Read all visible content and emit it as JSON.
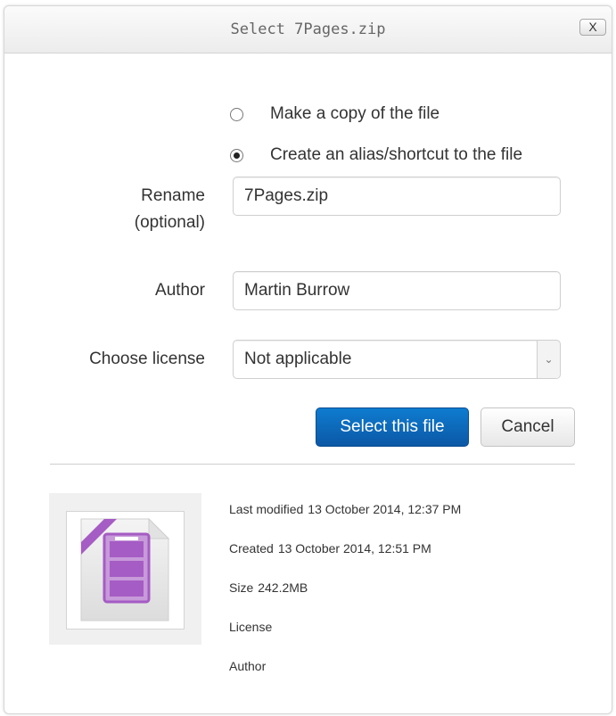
{
  "dialog": {
    "title": "Select 7Pages.zip",
    "close_label": "X"
  },
  "options": [
    {
      "label": "Make a copy of the file",
      "checked": false
    },
    {
      "label": "Create an alias/shortcut to the file",
      "checked": true
    }
  ],
  "form": {
    "rename_label_line1": "Rename",
    "rename_label_line2": "(optional)",
    "rename_value": "7Pages.zip",
    "author_label": "Author",
    "author_value": "Martin Burrow",
    "license_label": "Choose license",
    "license_value": "Not applicable"
  },
  "buttons": {
    "select": "Select this file",
    "cancel": "Cancel"
  },
  "file_info": {
    "last_modified_label": "Last modified",
    "last_modified_value": "13 October 2014, 12:37 PM",
    "created_label": "Created",
    "created_value": "13 October 2014, 12:51 PM",
    "size_label": "Size",
    "size_value": "242.2MB",
    "license_label": "License",
    "author_label": "Author"
  },
  "icons": {
    "file": "archive-file-icon",
    "select_arrow": "chevron-down-icon",
    "close": "close-icon"
  },
  "colors": {
    "primary_button": "#0c63b8",
    "archive_purple": "#a55cc4"
  }
}
